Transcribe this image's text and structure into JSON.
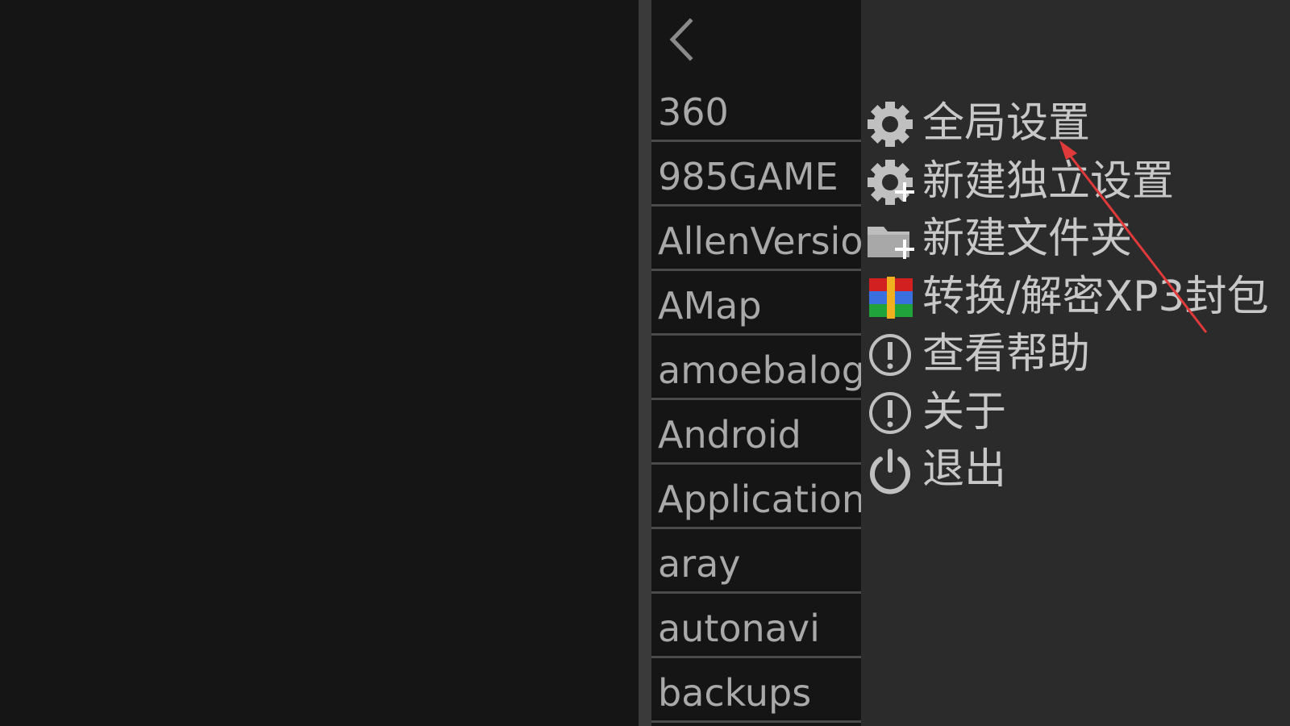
{
  "file_browser": {
    "back_icon": "chevron-left-icon",
    "items": [
      {
        "label": "360"
      },
      {
        "label": "985GAME"
      },
      {
        "label": "AllenVersion"
      },
      {
        "label": "AMap"
      },
      {
        "label": "amoebalog"
      },
      {
        "label": "Android"
      },
      {
        "label": "Application"
      },
      {
        "label": "aray"
      },
      {
        "label": "autonavi"
      },
      {
        "label": "backups"
      }
    ]
  },
  "menu": {
    "items": [
      {
        "label": "全局设置",
        "icon": "gear-icon"
      },
      {
        "label": "新建独立设置",
        "icon": "gear-plus-icon"
      },
      {
        "label": "新建文件夹",
        "icon": "folder-plus-icon"
      },
      {
        "label": "转换/解密XP3封包",
        "icon": "archive-icon"
      },
      {
        "label": "查看帮助",
        "icon": "info-icon"
      },
      {
        "label": "关于",
        "icon": "info-icon"
      },
      {
        "label": "退出",
        "icon": "power-icon"
      }
    ]
  },
  "colors": {
    "background": "#151515",
    "menu_background": "#2b2b2b",
    "text": "#c8c8c8",
    "list_text": "#a9a9a9",
    "annotation_arrow": "#e03a3a"
  }
}
